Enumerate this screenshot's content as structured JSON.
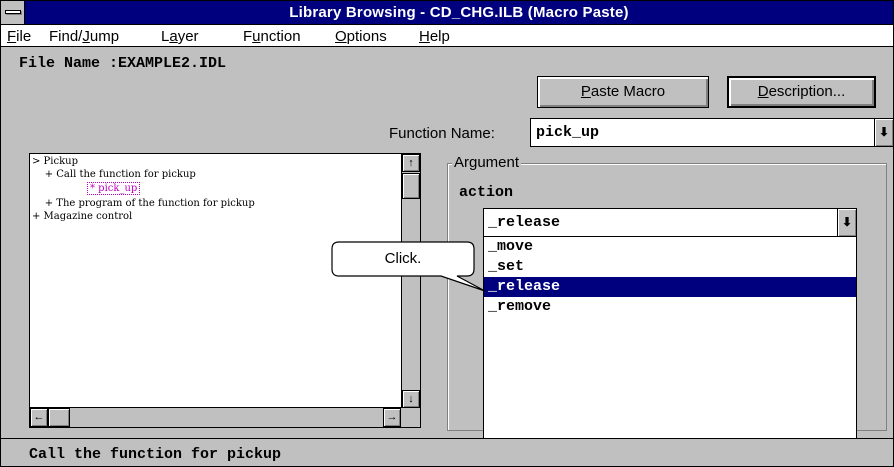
{
  "window": {
    "title": "Library Browsing - CD_CHG.ILB (Macro Paste)"
  },
  "menu": {
    "items": [
      {
        "pre": "",
        "key": "F",
        "post": "ile"
      },
      {
        "pre": "Find/",
        "key": "J",
        "post": "ump"
      },
      {
        "pre": "L",
        "key": "a",
        "post": "yer"
      },
      {
        "pre": "F",
        "key": "u",
        "post": "nction"
      },
      {
        "pre": "",
        "key": "O",
        "post": "ptions"
      },
      {
        "pre": "",
        "key": "H",
        "post": "elp"
      }
    ]
  },
  "file": {
    "label": "File Name :EXAMPLE2.IDL"
  },
  "buttons": {
    "paste_key": "P",
    "paste_rest": "aste Macro",
    "desc_key": "D",
    "desc_rest": "escription..."
  },
  "function": {
    "label": "Function Name:",
    "value": "pick_up"
  },
  "tree": {
    "lines": [
      "> Pickup",
      "    + Call the function for pickup",
      "* pick_up",
      "    + The program of the function for pickup",
      "+ Magazine control"
    ]
  },
  "argument": {
    "group_title": "Argument",
    "action_label": "action",
    "selected_value": "_release",
    "options": [
      "_move",
      "_set",
      "_release",
      "_remove"
    ],
    "selected_index": 2
  },
  "callout": {
    "text": "Click."
  },
  "status": {
    "text": "Call the function for pickup"
  },
  "icons": {
    "dropdown": "down-arrow-icon",
    "scroll_up": "up-arrow-icon",
    "scroll_down": "down-arrow-icon",
    "scroll_left": "left-arrow-icon",
    "scroll_right": "right-arrow-icon"
  },
  "colors": {
    "titlebar": "#00007f",
    "selection": "#00007f",
    "tree_highlight": "#c000c0",
    "face": "#c0c0c0"
  }
}
